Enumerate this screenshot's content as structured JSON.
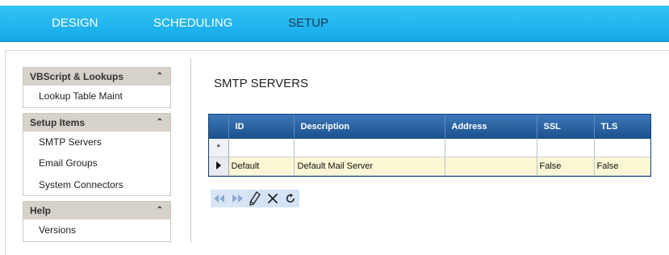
{
  "nav": {
    "design": "DESIGN",
    "scheduling": "SCHEDULING",
    "setup": "SETUP"
  },
  "sidebar": {
    "groups": [
      {
        "title": "VBScript & Lookups",
        "items": [
          "Lookup Table Maint"
        ]
      },
      {
        "title": "Setup Items",
        "items": [
          "SMTP Servers",
          "Email Groups",
          "System Connectors"
        ]
      },
      {
        "title": "Help",
        "items": [
          "Versions"
        ]
      }
    ]
  },
  "page": {
    "title": "SMTP SERVERS"
  },
  "grid": {
    "columns": [
      "ID",
      "Description",
      "Address",
      "SSL",
      "TLS"
    ],
    "new_row_marker": "*",
    "rows": [
      {
        "id": "Default",
        "description": "Default Mail Server",
        "address": "",
        "ssl": "False",
        "tls": "False"
      }
    ]
  },
  "toolbar": {
    "buttons": [
      "first-icon",
      "last-icon",
      "edit-icon",
      "delete-icon",
      "refresh-icon"
    ]
  },
  "colors": {
    "accent": "#14a9e7",
    "grid_header": "#1b4f8c",
    "selected_row": "#fbf6d3",
    "sidebar_header": "#d6d2ca"
  }
}
